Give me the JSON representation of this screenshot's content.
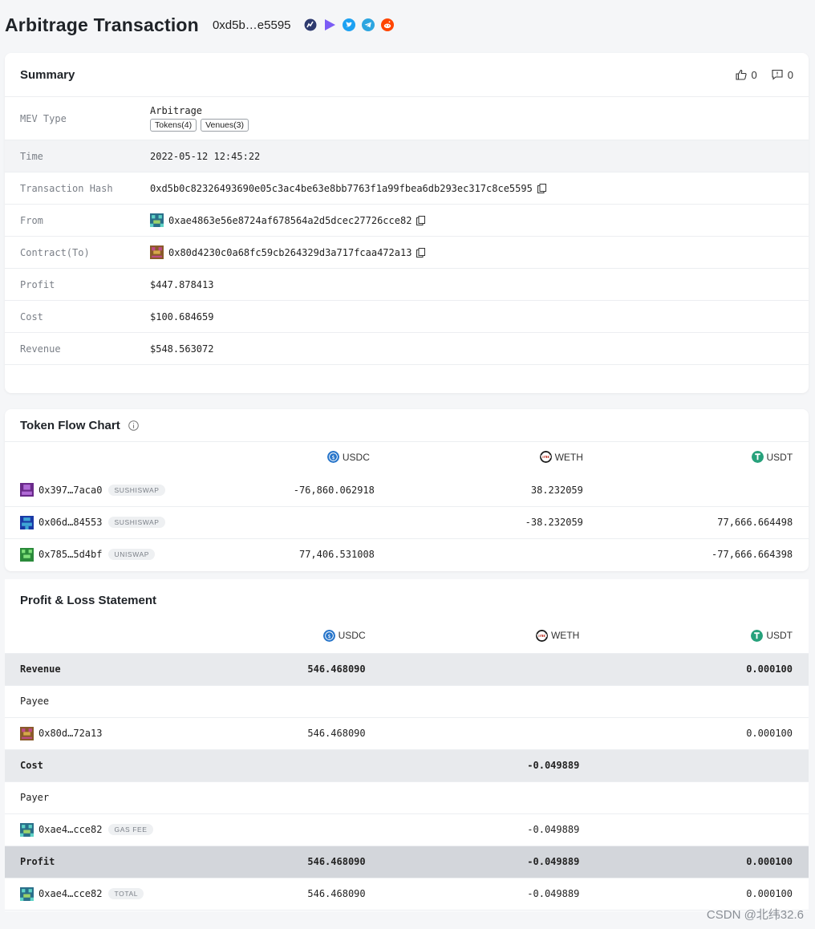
{
  "header": {
    "title": "Arbitrage Transaction",
    "tx_short": "0xd5b…e5595",
    "share_icons": [
      "chart-icon",
      "play-icon",
      "twitter-icon",
      "telegram-icon",
      "reddit-icon"
    ]
  },
  "summary": {
    "title": "Summary",
    "likes": "0",
    "comments": "0",
    "mev_type_label": "MEV Type",
    "mev_type_value": "Arbitrage",
    "tokens_tag": "Tokens(4)",
    "venues_tag": "Venues(3)",
    "time_label": "Time",
    "time_value": "2022-05-12 12:45:22",
    "hash_label": "Transaction Hash",
    "hash_value": "0xd5b0c82326493690e05c3ac4be63e8bb7763f1a99fbea6db293ec317c8ce5595",
    "from_label": "From",
    "from_value": "0xae4863e56e8724af678564a2d5dcec27726cce82",
    "contract_label": "Contract(To)",
    "contract_value": "0x80d4230c0a68fc59cb264329d3a717fcaa472a13",
    "profit_label": "Profit",
    "profit_value": "$447.878413",
    "cost_label": "Cost",
    "cost_value": "$100.684659",
    "revenue_label": "Revenue",
    "revenue_value": "$548.563072"
  },
  "token_flow": {
    "title": "Token Flow Chart",
    "tokens": [
      "USDC",
      "WETH",
      "USDT"
    ],
    "rows": [
      {
        "addr": "0x397…7aca0",
        "venue": "SUSHISWAP",
        "usdc": "-76,860.062918",
        "weth": "38.232059",
        "usdt": ""
      },
      {
        "addr": "0x06d…84553",
        "venue": "SUSHISWAP",
        "usdc": "",
        "weth": "-38.232059",
        "usdt": "77,666.664498"
      },
      {
        "addr": "0x785…5d4bf",
        "venue": "UNISWAP",
        "usdc": "77,406.531008",
        "weth": "",
        "usdt": "-77,666.664398"
      }
    ]
  },
  "pnl": {
    "title": "Profit & Loss Statement",
    "tokens": [
      "USDC",
      "WETH",
      "USDT"
    ],
    "revenue": {
      "label": "Revenue",
      "usdc": "546.468090",
      "weth": "",
      "usdt": "0.000100"
    },
    "payee_label": "Payee",
    "payee": {
      "addr": "0x80d…72a13",
      "usdc": "546.468090",
      "weth": "",
      "usdt": "0.000100"
    },
    "cost": {
      "label": "Cost",
      "usdc": "",
      "weth": "-0.049889",
      "usdt": ""
    },
    "payer_label": "Payer",
    "payer": {
      "addr": "0xae4…cce82",
      "tag": "GAS FEE",
      "usdc": "",
      "weth": "-0.049889",
      "usdt": ""
    },
    "profit": {
      "label": "Profit",
      "usdc": "546.468090",
      "weth": "-0.049889",
      "usdt": "0.000100"
    },
    "total": {
      "addr": "0xae4…cce82",
      "tag": "TOTAL",
      "usdc": "546.468090",
      "weth": "-0.049889",
      "usdt": "0.000100"
    }
  },
  "watermark": "CSDN @北纬32.6",
  "colors": {
    "usdc": "#2775ca",
    "weth": "#c0392b",
    "usdt": "#26a17b",
    "twitter": "#1da1f2",
    "telegram": "#2ca5e0",
    "reddit": "#ff4500",
    "play": "#7b5cf5"
  }
}
